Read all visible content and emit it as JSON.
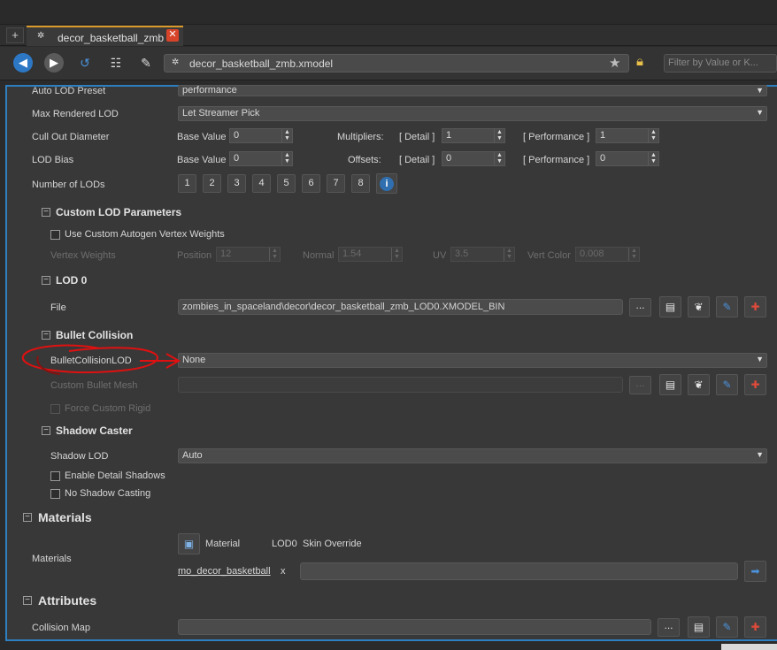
{
  "tab": {
    "title": "decor_basketball_zmb",
    "new_tab": "+",
    "close": "✕"
  },
  "toolbar": {
    "path": "decor_basketball_zmb.xmodel",
    "filter_placeholder": "Filter by Value or K..."
  },
  "lod_settings": {
    "auto_lod_preset_label": "Auto LOD Preset",
    "auto_lod_preset_value": "performance",
    "max_rendered_lod_label": "Max Rendered LOD",
    "max_rendered_lod_value": "Let Streamer Pick",
    "cull_out_diameter_label": "Cull Out Diameter",
    "lod_bias_label": "LOD Bias",
    "base_value_label": "Base Value",
    "cull_base_value": "0",
    "bias_base_value": "0",
    "multipliers_label": "Multipliers:",
    "offsets_label": "Offsets:",
    "detail_label": "[ Detail ]",
    "performance_label": "[ Performance ]",
    "cull_detail_value": "1",
    "cull_performance_value": "1",
    "bias_detail_value": "0",
    "bias_performance_value": "0",
    "number_of_lods_label": "Number of LODs",
    "lod_buttons": [
      "1",
      "2",
      "3",
      "4",
      "5",
      "6",
      "7",
      "8"
    ]
  },
  "custom_lod": {
    "heading": "Custom LOD Parameters",
    "use_custom_label": "Use Custom Autogen Vertex Weights",
    "vertex_weights_label": "Vertex Weights",
    "position_label": "Position",
    "position_value": "12",
    "normal_label": "Normal",
    "normal_value": "1.54",
    "uv_label": "UV",
    "uv_value": "3.5",
    "vert_color_label": "Vert Color",
    "vert_color_value": "0.008"
  },
  "lod0": {
    "heading": "LOD 0",
    "file_label": "File",
    "file_value": "zombies_in_spaceland\\decor\\decor_basketball_zmb_LOD0.XMODEL_BIN",
    "browse": "..."
  },
  "bullet_collision": {
    "heading": "Bullet Collision",
    "lod_label": "BulletCollisionLOD",
    "lod_value": "None",
    "custom_mesh_label": "Custom Bullet Mesh",
    "custom_mesh_value": "",
    "force_rigid_label": "Force Custom Rigid",
    "browse": "..."
  },
  "shadow_caster": {
    "heading": "Shadow Caster",
    "shadow_lod_label": "Shadow LOD",
    "shadow_lod_value": "Auto",
    "enable_detail_label": "Enable Detail Shadows",
    "no_shadow_label": "No Shadow Casting"
  },
  "materials": {
    "heading": "Materials",
    "row_label": "Materials",
    "col_material": "Material",
    "col_lod0": "LOD0",
    "col_skin_override": "Skin Override",
    "material_name": "mo_decor_basketball",
    "x_mark": "x",
    "override_value": ""
  },
  "attributes": {
    "heading": "Attributes",
    "collision_map_label": "Collision Map",
    "collision_map_value": "",
    "browse": "..."
  },
  "colors": {
    "accent_border": "#2e7fc0",
    "tab_highlight": "#d99a2b",
    "annotation_red": "#e01010",
    "close_red": "#d8442a"
  }
}
